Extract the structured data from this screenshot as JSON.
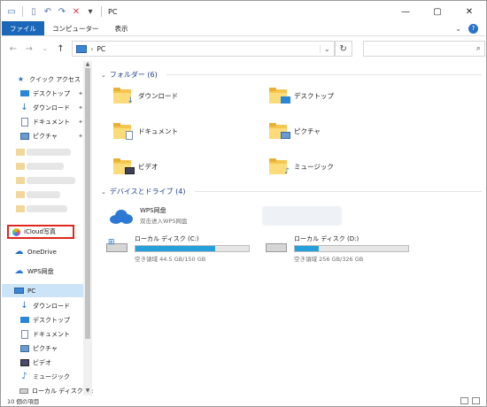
{
  "window": {
    "title": "PC"
  },
  "titlebar": {
    "dropdown_glyph": "▾"
  },
  "ribbon": {
    "tabs": [
      {
        "label": "ファイル",
        "active": true
      },
      {
        "label": "コンピューター",
        "active": false
      },
      {
        "label": "表示",
        "active": false
      }
    ]
  },
  "address": {
    "path_sep": "›",
    "path": "PC"
  },
  "sidebar": {
    "quick_access": "クイック アクセス",
    "items": [
      {
        "label": "デスクトップ",
        "icon": "desktop-icon",
        "pinned": true
      },
      {
        "label": "ダウンロード",
        "icon": "download-icon",
        "pinned": true
      },
      {
        "label": "ドキュメント",
        "icon": "documents-icon",
        "pinned": true
      },
      {
        "label": "ピクチャ",
        "icon": "pictures-icon",
        "pinned": true
      }
    ],
    "icloud": "iCloud写真",
    "onedrive": "OneDrive",
    "wps": "WPS网盘",
    "pc": "PC",
    "pc_items": [
      {
        "label": "ダウンロード",
        "icon": "download-icon"
      },
      {
        "label": "デスクトップ",
        "icon": "desktop-icon"
      },
      {
        "label": "ドキュメント",
        "icon": "documents-icon"
      },
      {
        "label": "ピクチャ",
        "icon": "pictures-icon"
      },
      {
        "label": "ビデオ",
        "icon": "videos-icon"
      },
      {
        "label": "ミュージック",
        "icon": "music-icon"
      },
      {
        "label": "ローカル ディスク (C:)",
        "icon": "drive-icon"
      }
    ]
  },
  "main": {
    "folders_header": "フォルダー (6)",
    "folders": [
      {
        "label": "ダウンロード",
        "icon": "download-folder-icon"
      },
      {
        "label": "デスクトップ",
        "icon": "desktop-folder-icon"
      },
      {
        "label": "ドキュメント",
        "icon": "documents-folder-icon"
      },
      {
        "label": "ピクチャ",
        "icon": "pictures-folder-icon"
      },
      {
        "label": "ビデオ",
        "icon": "videos-folder-icon"
      },
      {
        "label": "ミュージック",
        "icon": "music-folder-icon"
      }
    ],
    "devices_header": "デバイスとドライブ (4)",
    "wps": {
      "name": "WPS网盘",
      "sub": "双击进入WPS网盘"
    },
    "drives": [
      {
        "name": "ローカル ディスク (C:)",
        "free": "空き領域 44.5 GB/150 GB",
        "used_fraction": 0.7
      },
      {
        "name": "ローカル ディスク (D:)",
        "free": "空き領域 256 GB/326 GB",
        "used_fraction": 0.21
      }
    ]
  },
  "status": {
    "items": "10 個の項目"
  },
  "colors": {
    "accent": "#1a66b8",
    "selection": "#cce4f7",
    "highlight_border": "#e0271e",
    "progress": "#26a0da"
  }
}
